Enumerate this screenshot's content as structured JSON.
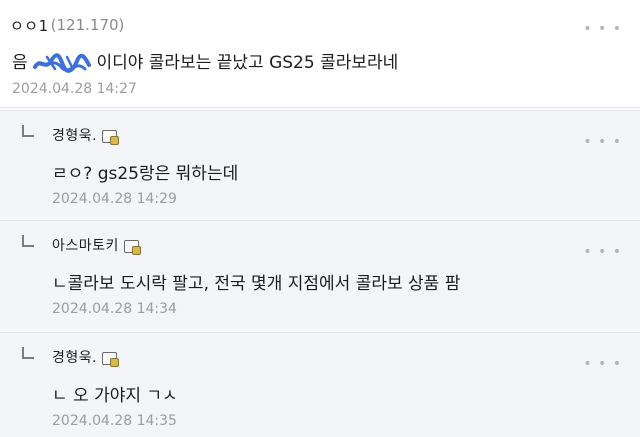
{
  "comments": [
    {
      "nick": "ㅇㅇ1",
      "ip": "(121.170)",
      "text_before": "음",
      "text_after": "이디야 콜라보는 끝났고 GS25 콜라보라네",
      "date": "2024.04.28 14:27"
    }
  ],
  "replies": [
    {
      "nick": "경형욱.",
      "text": "ㄹㅇ? gs25랑은 뭐하는데",
      "date": "2024.04.28 14:29"
    },
    {
      "nick": "아스마토키",
      "text": "ㄴ콜라보 도시락 팔고, 전국 몇개 지점에서 콜라보 상품 팜",
      "date": "2024.04.28 14:34"
    },
    {
      "nick": "경형욱.",
      "text": "ㄴ 오 가야지 ㄱㅅ",
      "date": "2024.04.28 14:35"
    }
  ],
  "colors": {
    "reply_bg": "#f4f5f9",
    "scribble": "#3f6fd8",
    "date": "#9d9d9d"
  }
}
